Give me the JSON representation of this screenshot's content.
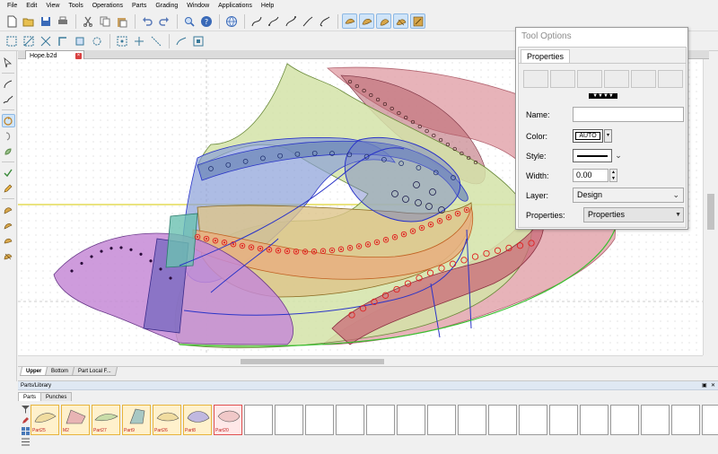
{
  "menu": [
    "File",
    "Edit",
    "View",
    "Tools",
    "Operations",
    "Parts",
    "Grading",
    "Window",
    "Applications",
    "Help"
  ],
  "document_tab": {
    "title": "Hope.b2d"
  },
  "sheet_tabs": [
    "Upper",
    "Bottom",
    "Part Local F..."
  ],
  "parts_library": {
    "title": "Parts/Library",
    "tabs": [
      "Parts",
      "Punches"
    ],
    "items": [
      {
        "label": "Part25",
        "color": "#f0dca0"
      },
      {
        "label": "M2",
        "color": "#e8b4b4"
      },
      {
        "label": "Part27",
        "color": "#c8dca8"
      },
      {
        "label": "Part9",
        "color": "#a8c8c4"
      },
      {
        "label": "Part26",
        "color": "#f0dca0"
      },
      {
        "label": "Part8",
        "color": "#c0b8e0"
      },
      {
        "label": "Part20",
        "color": "#f0c8c8"
      }
    ],
    "empty_slots": 16
  },
  "tool_options": {
    "title": "Tool Options",
    "tab": "Properties",
    "name_label": "Name:",
    "name_value": "",
    "color_label": "Color:",
    "color_value": "AUTO",
    "style_label": "Style:",
    "width_label": "Width:",
    "width_value": "0.00",
    "layer_label": "Layer:",
    "layer_value": "Design",
    "properties_label": "Properties:",
    "properties_value": "Properties"
  },
  "colors": {
    "green_piece": "#d3e3a8",
    "pink_piece": "#e3a6ad",
    "purple_piece": "#c58ad6",
    "blue_piece": "#8aa0d8",
    "tan_piece": "#ddc48a",
    "stroke_accent": "#2a34c8",
    "punch_red": "#e02020"
  }
}
